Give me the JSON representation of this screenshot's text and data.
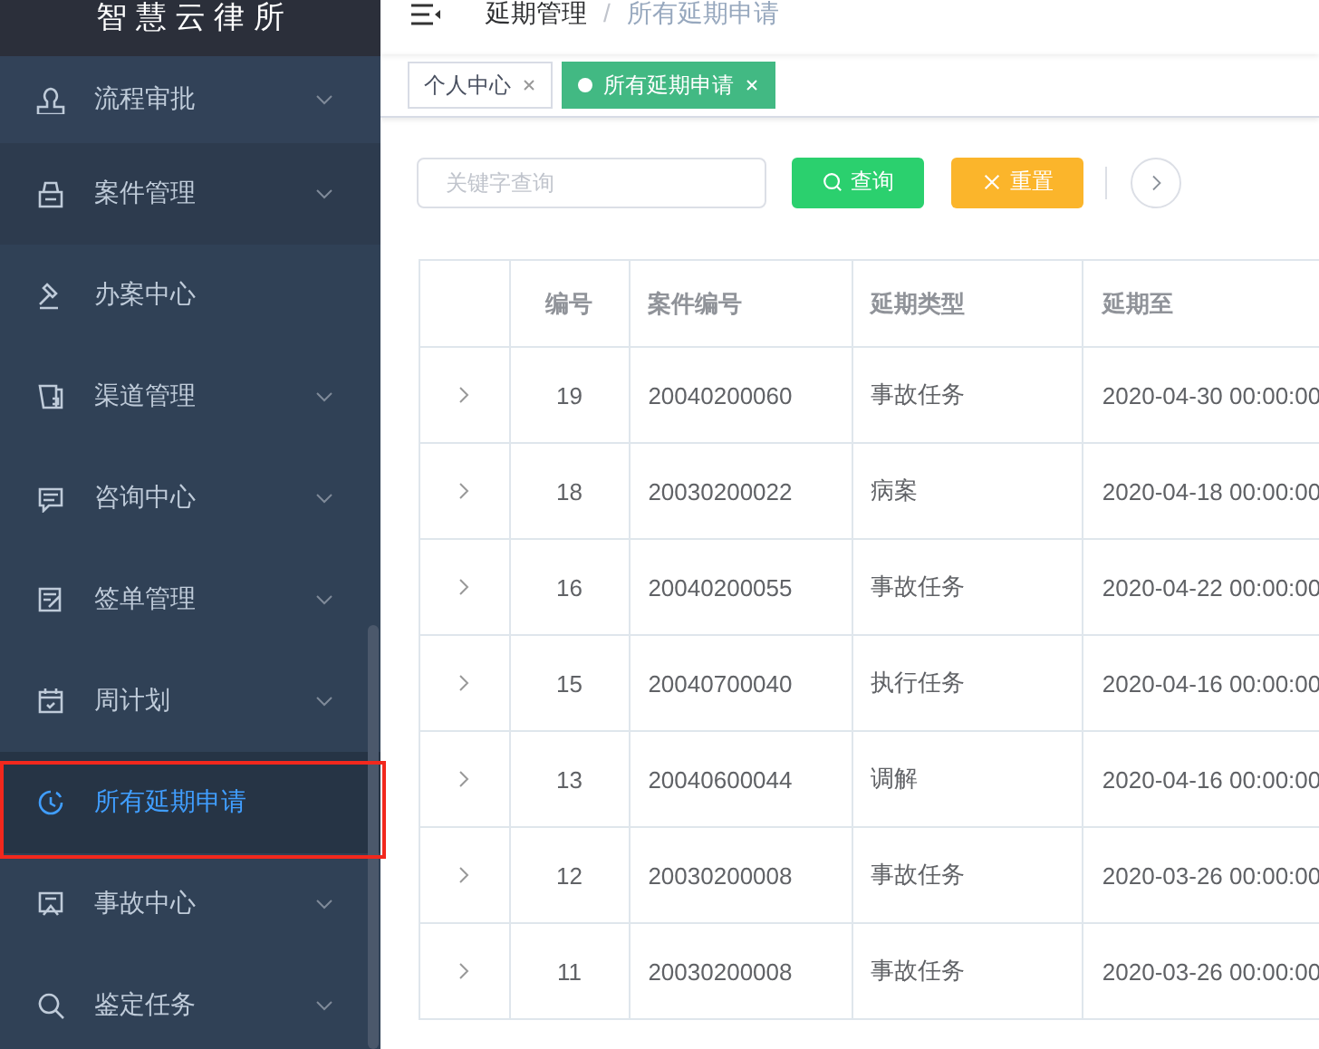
{
  "sidebar": {
    "logo": "智 慧 云 律 所",
    "items": [
      {
        "label": "流程审批",
        "expandable": true,
        "selected": false
      },
      {
        "label": "案件管理",
        "expandable": true,
        "selected": false
      },
      {
        "label": "办案中心",
        "expandable": false,
        "selected": false
      },
      {
        "label": "渠道管理",
        "expandable": true,
        "selected": false
      },
      {
        "label": "咨询中心",
        "expandable": true,
        "selected": false
      },
      {
        "label": "签单管理",
        "expandable": true,
        "selected": false
      },
      {
        "label": "周计划",
        "expandable": true,
        "selected": false
      },
      {
        "label": "所有延期申请",
        "expandable": false,
        "selected": true
      },
      {
        "label": "事故中心",
        "expandable": true,
        "selected": false
      },
      {
        "label": "鉴定任务",
        "expandable": true,
        "selected": false
      }
    ]
  },
  "breadcrumb": [
    "延期管理",
    "所有延期申请"
  ],
  "breadcrumb_separator": "/",
  "tabs": [
    {
      "label": "个人中心",
      "selected": false
    },
    {
      "label": "所有延期申请",
      "selected": true
    }
  ],
  "toolbar": {
    "search": {
      "placeholder": "关键字查询"
    },
    "query_button": "查询",
    "reset_button": "重置"
  },
  "table": {
    "columns": [
      "编号",
      "案件编号",
      "延期类型",
      "延期至"
    ],
    "rows": [
      [
        "19",
        "20040200060",
        "事故任务",
        "2020-04-30 00:00:00"
      ],
      [
        "18",
        "20030200022",
        "病案",
        "2020-04-18 00:00:00"
      ],
      [
        "16",
        "20040200055",
        "事故任务",
        "2020-04-22 00:00:00"
      ],
      [
        "15",
        "20040700040",
        "执行任务",
        "2020-04-16 00:00:00"
      ],
      [
        "13",
        "20040600044",
        "调解",
        "2020-04-16 00:00:00"
      ],
      [
        "12",
        "20030200008",
        "事故任务",
        "2020-03-26 00:00:00"
      ],
      [
        "11",
        "20030200008",
        "事故任务",
        "2020-03-26 00:00:00"
      ]
    ]
  }
}
